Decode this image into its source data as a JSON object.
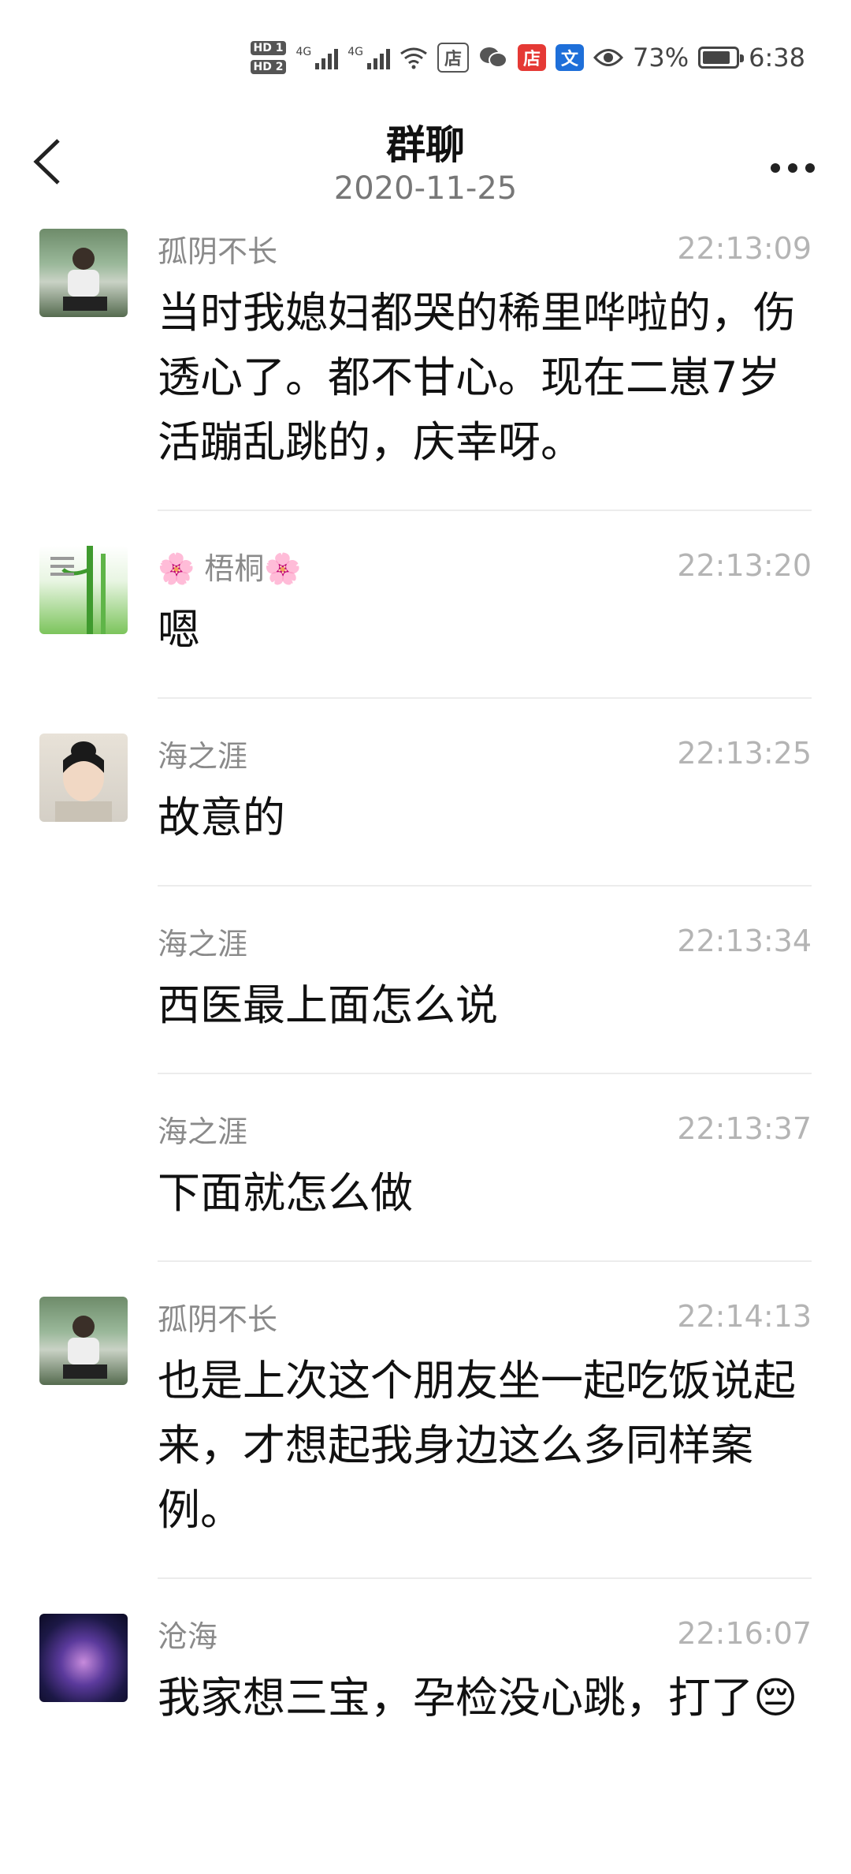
{
  "status_bar": {
    "battery_percent": "73%",
    "time": "6:38",
    "network": "4G",
    "hd1": "HD 1",
    "hd2": "HD 2"
  },
  "header": {
    "title": "群聊",
    "date": "2020-11-25"
  },
  "messages": [
    {
      "sender": "孤阴不长",
      "time": "22:13:09",
      "text": "当时我媳妇都哭的稀里哗啦的，伤透心了。都不甘心。现在二崽7岁活蹦乱跳的，庆幸呀。"
    },
    {
      "sender": "🌸 梧桐🌸",
      "time": "22:13:20",
      "text": "嗯"
    },
    {
      "sender": "海之涯",
      "time": "22:13:25",
      "text": "故意的"
    },
    {
      "sender": "海之涯",
      "time": "22:13:34",
      "text": "西医最上面怎么说"
    },
    {
      "sender": "海之涯",
      "time": "22:13:37",
      "text": "下面就怎么做"
    },
    {
      "sender": "孤阴不长",
      "time": "22:14:13",
      "text": "也是上次这个朋友坐一起吃饭说起来，才想起我身边这么多同样案例。"
    },
    {
      "sender": "沧海",
      "time": "22:16:07",
      "text": "我家想三宝，孕检没心跳，打了😔"
    }
  ],
  "colors": {
    "background": "#ffffff",
    "sender": "#8a8a8a",
    "time": "#b4b4b4",
    "text": "#111111",
    "divider": "#ececec"
  }
}
